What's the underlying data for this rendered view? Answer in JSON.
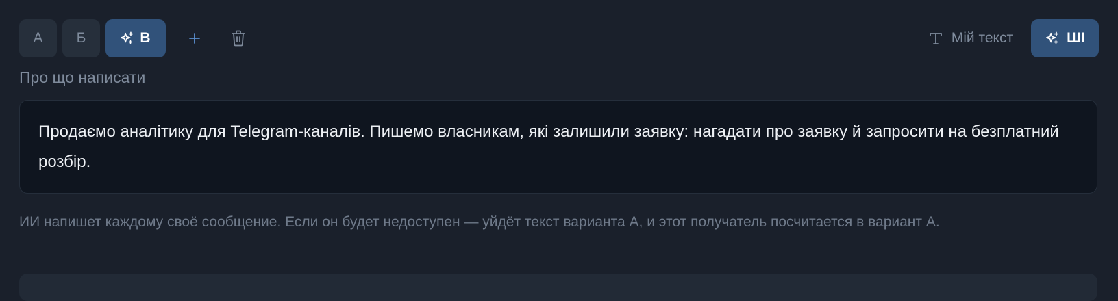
{
  "variants": {
    "tabs": [
      {
        "label": "А",
        "active": false
      },
      {
        "label": "Б",
        "active": false
      },
      {
        "label": "В",
        "active": true
      }
    ],
    "add_icon": "plus-icon",
    "delete_icon": "trash-icon"
  },
  "mode": {
    "my_text_label": "Мій текст",
    "my_text_icon": "text-t-icon",
    "ai_label": "ШІ",
    "ai_icon": "sparkles-icon"
  },
  "prompt": {
    "label": "Про що написати",
    "value": "Продаємо аналітику для Telegram-каналів. Пишемо власникам, які залишили заявку: нагадати про заявку й запросити на безплатний розбір."
  },
  "hint": "ИИ напишет каждому своё сообщение. Если он будет недоступен — уйдёт текст варианта А, и этот получатель посчитается в вариант А.",
  "colors": {
    "background": "#1a202b",
    "accent": "#31527a",
    "input_bg": "#0f151f",
    "muted_text": "#7f8b9c"
  }
}
